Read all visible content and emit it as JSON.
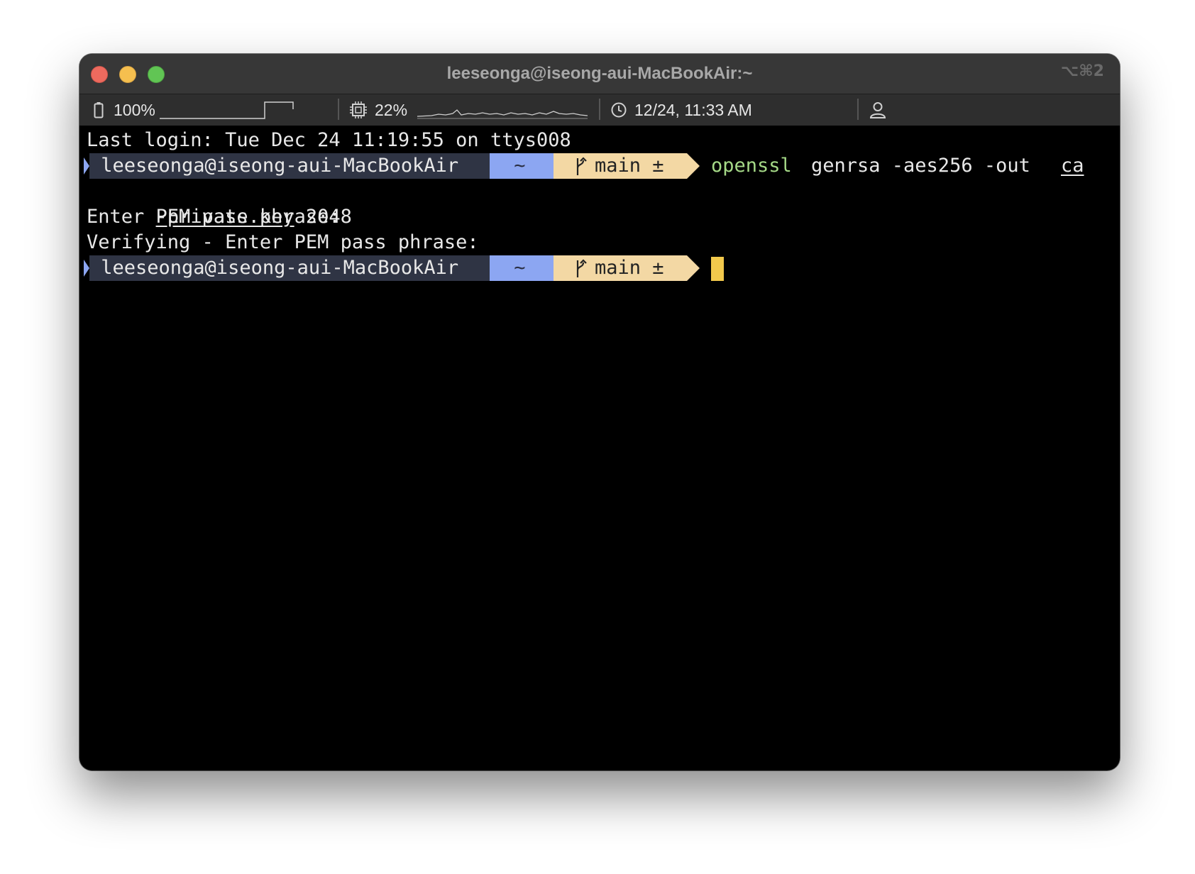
{
  "window": {
    "title": "leeseonga@iseong-aui-MacBookAir:~",
    "shortcut": "⌥⌘2"
  },
  "statusbar": {
    "battery": {
      "icon": "battery-icon",
      "label": "100%"
    },
    "cpu": {
      "icon": "cpu-icon",
      "label": "22%"
    },
    "clock": {
      "icon": "clock-icon",
      "label": "12/24, 11:33 AM"
    },
    "user": {
      "icon": "user-icon"
    }
  },
  "terminal": {
    "last_login": "Last login: Tue Dec 24 11:19:55 on ttys008",
    "prompt": {
      "user_host": " leeseonga@iseong-aui-MacBookAir ",
      "dir": " ~ ",
      "branch_icon": "git-branch-icon",
      "branch": "main ±"
    },
    "command": {
      "program": "openssl",
      "args": "genrsa -aes256 -out",
      "file_part1": "ca",
      "file_part2": "-private.key",
      "key_size": "2048"
    },
    "output": [
      "Enter PEM pass phrase:",
      "Verifying - Enter PEM pass phrase:"
    ]
  },
  "colors": {
    "user_segment": "#2f3444",
    "dir_segment": "#8ca6f2",
    "git_segment": "#f3d8a4",
    "command_green": "#a5d987",
    "cursor": "#f2c94c"
  }
}
